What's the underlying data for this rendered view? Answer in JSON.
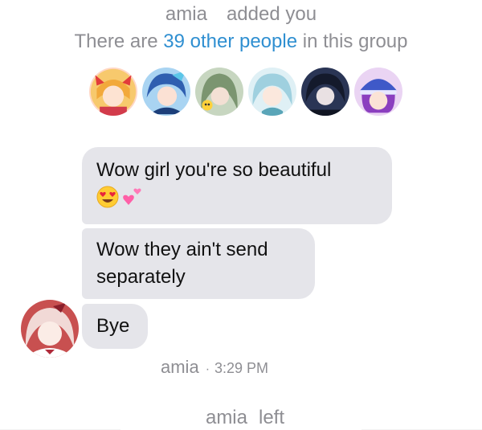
{
  "system": {
    "added_name": "amia",
    "added_text": "added you",
    "count_prefix": "There are",
    "count_link": "39 other people",
    "count_suffix": "in this group",
    "left_name": "amia",
    "left_text": "left"
  },
  "members": [
    {
      "icon": "member-avatar-1",
      "color": "#f4b25d"
    },
    {
      "icon": "member-avatar-2",
      "color": "#3e78c9"
    },
    {
      "icon": "member-avatar-3",
      "color": "#6d8a5f"
    },
    {
      "icon": "member-avatar-4",
      "color": "#8fc3d6"
    },
    {
      "icon": "member-avatar-5",
      "color": "#1e2740"
    },
    {
      "icon": "member-avatar-6",
      "color": "#8a44b8"
    }
  ],
  "messages": [
    {
      "text": "Wow girl you're so beautiful",
      "emoji": [
        "smiling-face-heart-eyes",
        "two-hearts"
      ]
    },
    {
      "text_line1": "Wow they ain't send",
      "text_line2": "separately"
    },
    {
      "text": "Bye"
    }
  ],
  "footer": {
    "sender": "amia",
    "separator": "·",
    "time": "3:29 PM"
  },
  "colors": {
    "bubble": "#e5e5ea",
    "system_text": "#8e8e93",
    "link": "#2f8fd1"
  }
}
